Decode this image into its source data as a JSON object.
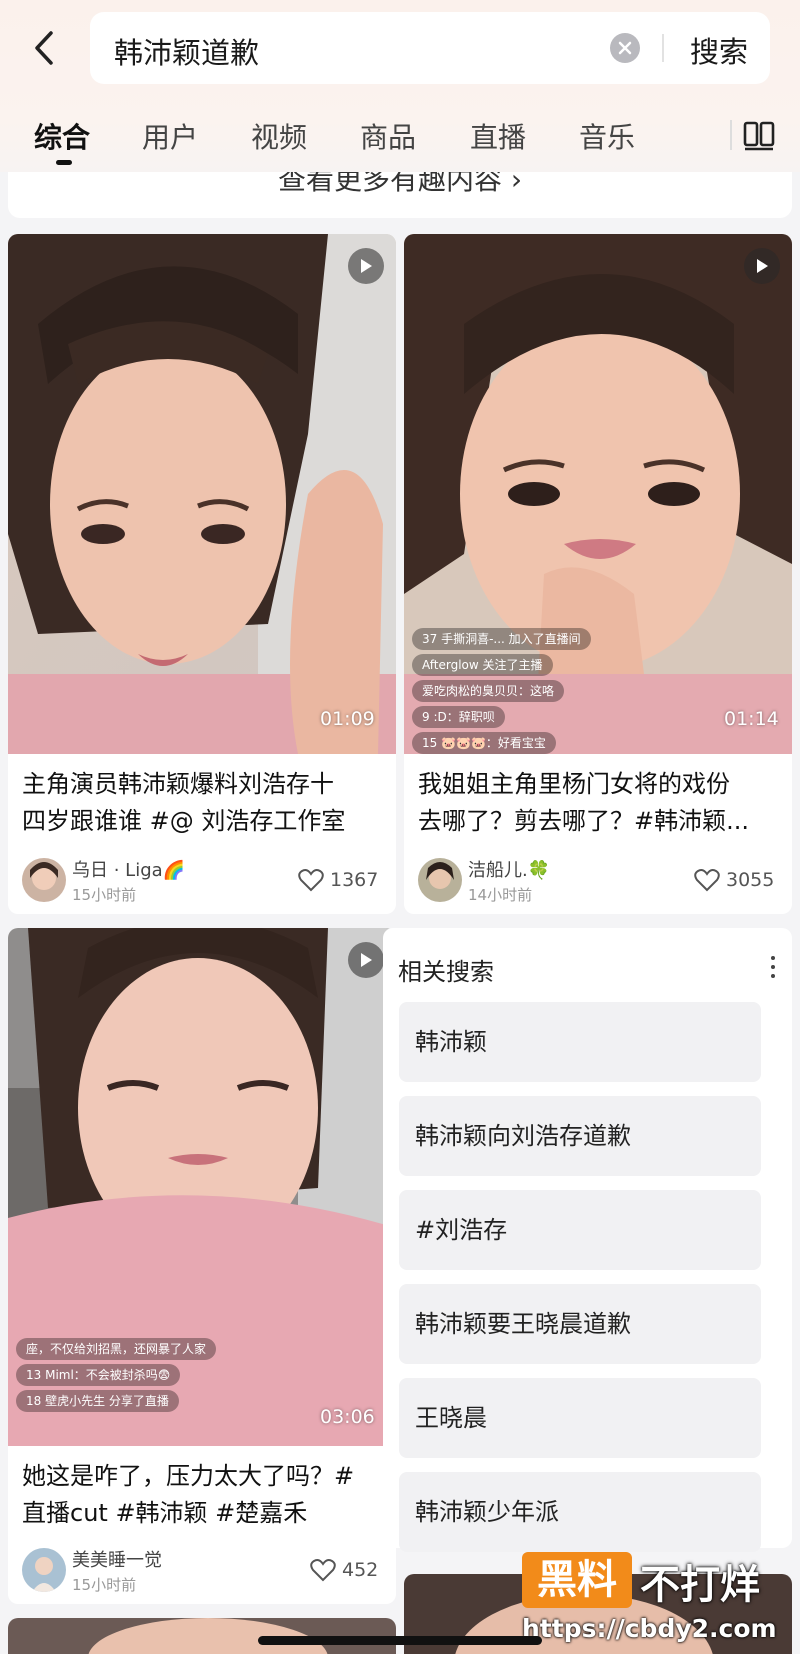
{
  "search": {
    "query": "韩沛颖道歉",
    "button": "搜索"
  },
  "tabs": [
    "综合",
    "用户",
    "视频",
    "商品",
    "直播",
    "音乐"
  ],
  "top_partial_text": "查看更多有趣内容 ›",
  "cards": [
    {
      "duration": "01:09",
      "title_lines": [
        "主角演员韩沛颖爆料刘浩存十",
        "四岁跟谁谁 #@ 刘浩存工作室"
      ],
      "author": "乌日 · Liga🌈",
      "time": "15小时前",
      "likes": "1367",
      "comments": []
    },
    {
      "duration": "01:14",
      "title_lines": [
        "我姐姐主角里杨门女将的戏份",
        "去哪了？剪去哪了？#韩沛颖..."
      ],
      "author": "洁船儿.🍀",
      "time": "14小时前",
      "likes": "3055",
      "comments": [
        "37 手撕洞喜-... 加入了直播间",
        "Afterglow 关注了主播",
        "爱吃肉松的臭贝贝：这咯",
        "9 :D：辞职呗",
        "15 🐷🐷🐷：好看宝宝"
      ]
    },
    {
      "duration": "03:06",
      "title_lines": [
        "她这是咋了，压力太大了吗？#",
        "直播cut #韩沛颖 #楚嘉禾"
      ],
      "author": "美美睡一觉",
      "time": "15小时前",
      "likes": "452",
      "comments": [
        "座，不仅给刘招黑，还网暴了人家",
        "13 Miml：不会被封杀吗😨",
        "18 壁虎小先生 分享了直播"
      ]
    }
  ],
  "related": {
    "title": "相关搜索",
    "items": [
      "韩沛颖",
      "韩沛颖向刘浩存道歉",
      "#刘浩存",
      "韩沛颖要王晓晨道歉",
      "王晓晨",
      "韩沛颖少年派"
    ]
  },
  "watermark": {
    "box": "黑料",
    "text": "不打烊",
    "url": "https://cbdy2.com"
  }
}
